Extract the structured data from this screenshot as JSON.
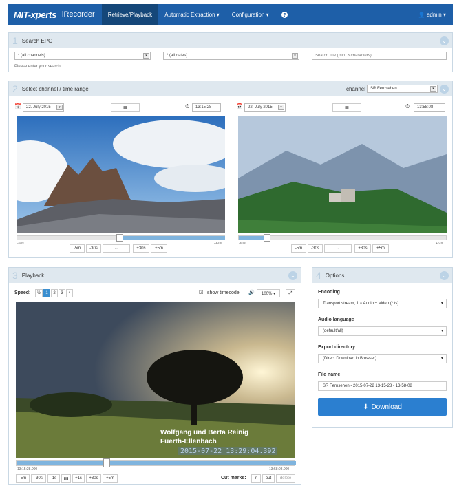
{
  "nav": {
    "brand": "MIT-xperts",
    "app": "iRecorder",
    "items": [
      "Retrieve/Playback",
      "Automatic Extraction ▾",
      "Configuration ▾"
    ],
    "help": "❓",
    "user": "admin ▾"
  },
  "epg": {
    "num": "1",
    "title": "Search EPG",
    "channels": "* (all channels)",
    "dates": "* (all dates)",
    "search_placeholder": "Search title (min. 3 characters)",
    "hint": "Please enter your search"
  },
  "select": {
    "num": "2",
    "title": "Select channel / time range",
    "channel_label": "channel",
    "channel": "SR Fernsehen",
    "left": {
      "date": "22. July 2015",
      "time": "13:15:28"
    },
    "right": {
      "date": "22. July 2015",
      "time": "13:58:08"
    },
    "range_min": "-60s",
    "range_max": "+60s",
    "buttons": [
      "-5m",
      "-30s",
      "↔",
      "+30s",
      "+5m"
    ],
    "left_handle_fraction": 0.43,
    "right_handle_fraction": 0.12
  },
  "playback": {
    "num": "3",
    "title": "Playback",
    "speed_label": "Speed:",
    "speeds": [
      "½",
      "1",
      "2",
      "3",
      "4"
    ],
    "show_timecode": "show timecode",
    "volume": "100% ▾",
    "overlay_line1": "Wolfgang und Berta Reinig",
    "overlay_line2": "Fuerth-Ellenbach",
    "overlay_time": "2015-07-22 13:29:04.392",
    "start": "13:15:28.000",
    "end": "13:58:08.000",
    "position_fraction": 0.33,
    "controls": [
      "-5m",
      "-30s",
      "-1s",
      "▮▮",
      "+1s",
      "+30s",
      "+5m"
    ],
    "cut_label": "Cut marks:",
    "cut_buttons": [
      "in",
      "out",
      "delete"
    ]
  },
  "options": {
    "num": "4",
    "title": "Options",
    "encoding_label": "Encoding",
    "encoding": "Transport stream, 1 × Audio + Video (*.ts)",
    "audio_label": "Audio language",
    "audio": "(default/all)",
    "export_label": "Export directory",
    "export": "(Direct Download in Browser)",
    "filename_label": "File name",
    "filename": "SR Fernsehen - 2015-07-22 13-15-28 - 13-58-08",
    "download": "Download"
  }
}
